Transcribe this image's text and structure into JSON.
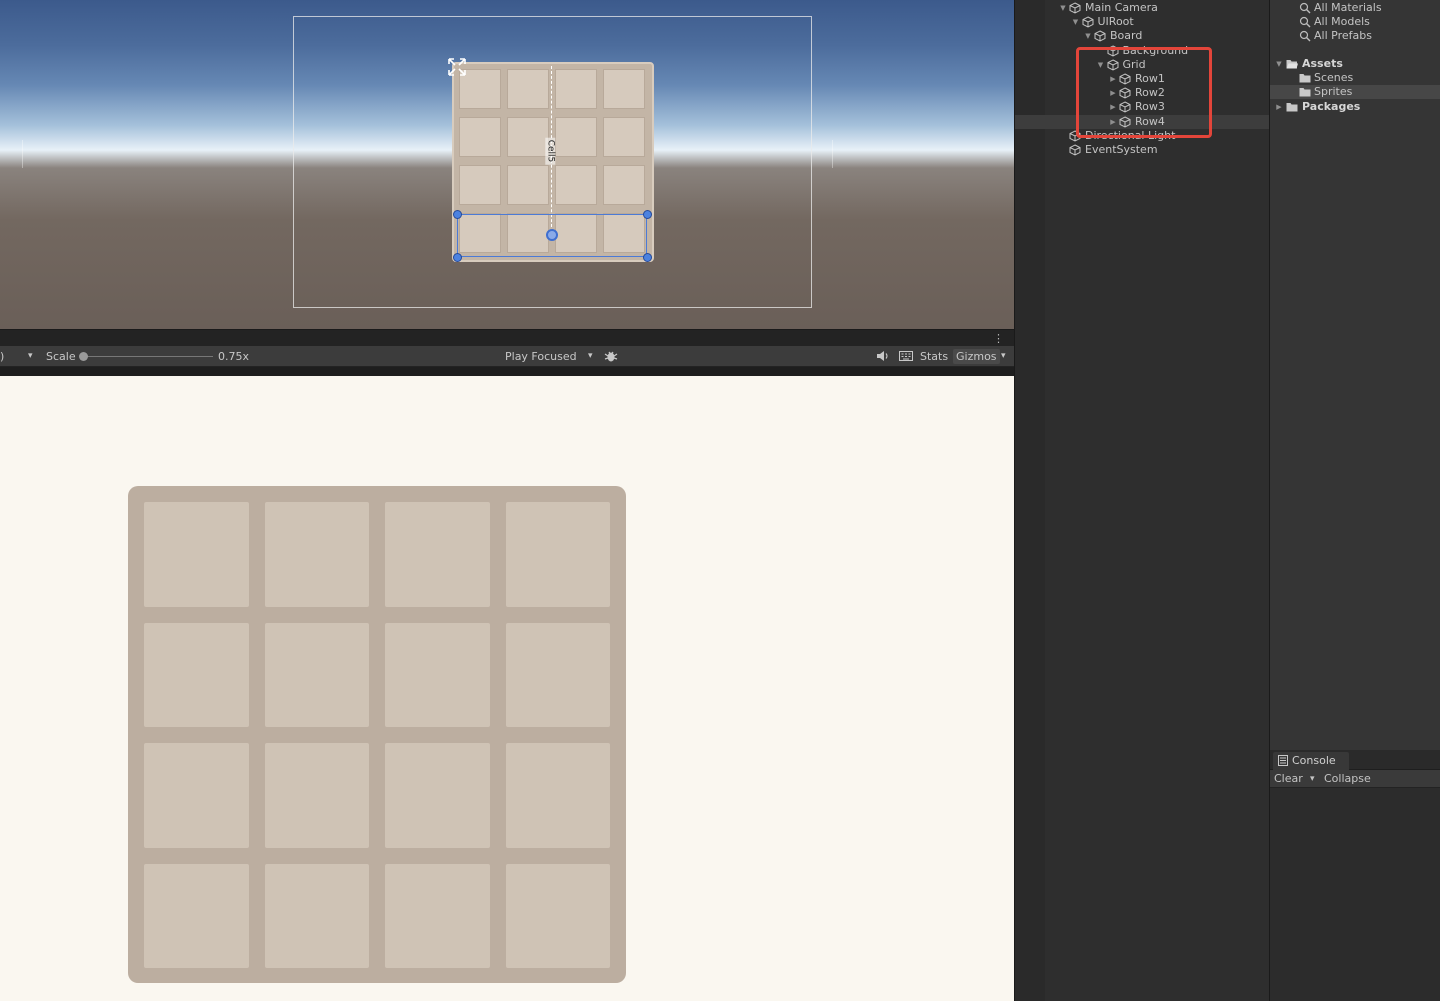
{
  "game_toolbar": {
    "left_fragment": ")",
    "dropdown_glyph": "▾",
    "scale_label": "Scale",
    "scale_value": "0.75x",
    "play_focused": "Play Focused",
    "stats": "Stats",
    "gizmos": "Gizmos",
    "more_glyph": "⋮",
    "scale_fraction": 0.0
  },
  "scene": {
    "rotated_label": "Cell5"
  },
  "board": {
    "rows": 4,
    "cols": 4,
    "colors": {
      "board": "#bcaea0",
      "cell": "#cfc3b5",
      "background": "#faf7f0"
    }
  },
  "hierarchy": {
    "items": [
      {
        "label": "Main Camera",
        "indent": 0,
        "fold": "▼"
      },
      {
        "label": "UIRoot",
        "indent": 1,
        "fold": "▼"
      },
      {
        "label": "Board",
        "indent": 2,
        "fold": "▼"
      },
      {
        "label": "Background",
        "indent": 3,
        "fold": ""
      },
      {
        "label": "Grid",
        "indent": 3,
        "fold": "▼"
      },
      {
        "label": "Row1",
        "indent": 4,
        "fold": "▶"
      },
      {
        "label": "Row2",
        "indent": 4,
        "fold": "▶"
      },
      {
        "label": "Row3",
        "indent": 4,
        "fold": "▶"
      },
      {
        "label": "Row4",
        "indent": 4,
        "fold": "▶"
      },
      {
        "label": "Directional Light",
        "indent": 0,
        "fold": ""
      },
      {
        "label": "EventSystem",
        "indent": 0,
        "fold": ""
      }
    ],
    "highlight_color": "#e3453a"
  },
  "project": {
    "favorites": [
      "All Materials",
      "All Models",
      "All Prefabs"
    ],
    "assets_label": "Assets",
    "asset_children": [
      "Scenes",
      "Sprites"
    ],
    "packages_label": "Packages"
  },
  "console": {
    "tab_label": "Console",
    "clear_label": "Clear",
    "collapse_label": "Collapse"
  }
}
